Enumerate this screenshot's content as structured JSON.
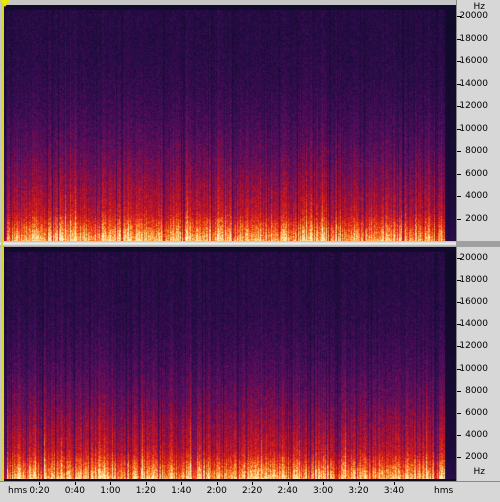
{
  "frequency_axis": {
    "unit": "Hz",
    "labels": [
      "20000",
      "18000",
      "16000",
      "14000",
      "12000",
      "10000",
      "8000",
      "6000",
      "4000",
      "2000"
    ],
    "max_hz": 21000
  },
  "time_axis": {
    "unit_label": "hms",
    "labels": [
      "0:20",
      "0:40",
      "1:00",
      "1:20",
      "1:40",
      "2:00",
      "2:20",
      "2:40",
      "3:00",
      "3:20",
      "3:40"
    ],
    "duration_seconds": 255
  },
  "channels": [
    {
      "id": "left"
    },
    {
      "id": "right"
    }
  ],
  "colors": {
    "background": "#0b0a22",
    "low_energy": "#2b0c4a",
    "mid_energy": "#b0102a",
    "high_energy": "#ffd070",
    "playhead": "#e8e800"
  },
  "icons": {
    "playhead_marker": "triangle-down-icon"
  }
}
